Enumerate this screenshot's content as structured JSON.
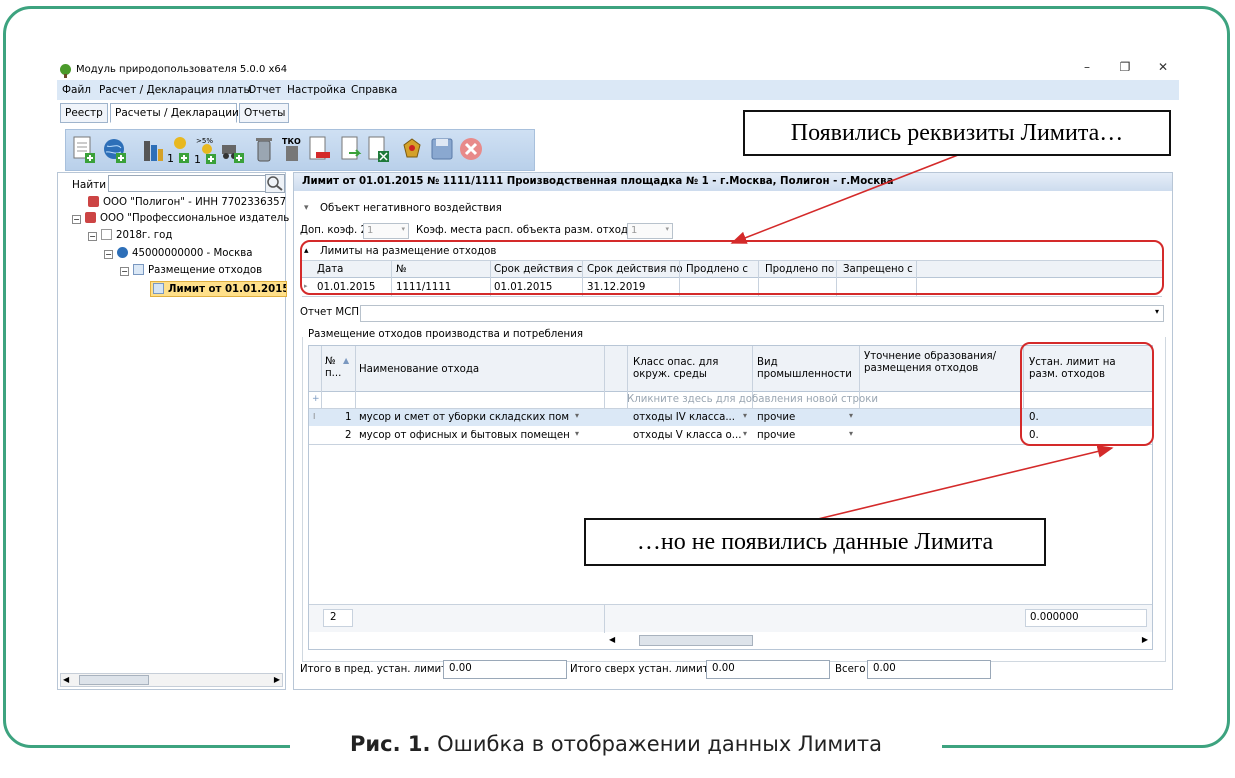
{
  "window": {
    "title": "Модуль природопользователя 5.0.0 x64"
  },
  "menu": [
    "Файл",
    "Расчет / Декларация платы",
    "Отчет",
    "Настройка",
    "Справка"
  ],
  "tabs": [
    {
      "label": "Реестр"
    },
    {
      "label": "Расчеты / Декларации"
    },
    {
      "label": "Отчеты"
    }
  ],
  "toolbar": {
    "badges": {
      "one_a": "1",
      "pct": ">5%",
      "one_b": "1",
      "tko": "ТКО"
    }
  },
  "search": {
    "label": "Найти",
    "value": ""
  },
  "tree": [
    {
      "label": "ООО \"Полигон\" - ИНН 7702336357"
    },
    {
      "label": "ООО \"Профессиональное издатель"
    },
    {
      "label": "2018г. год"
    },
    {
      "label": "45000000000 - Москва"
    },
    {
      "label": "Размещение отходов"
    },
    {
      "label": "Лимит от 01.01.2015 N"
    }
  ],
  "detail": {
    "header": "Лимит от 01.01.2015 № 1111/1111 Производственная площадка № 1 - г.Москва, Полигон - г.Москва",
    "object_section": "Объект негативного воздействия",
    "dop_koef_label": "Доп. коэф. 2",
    "dop_koef_value": "1",
    "koef_place_label": "Коэф. места расп. объекта разм. отходов",
    "koef_place_value": "1",
    "limits_section": "Лимиты на размещение отходов",
    "limits_columns": [
      "Дата",
      "№",
      "Срок действия с",
      "Срок действия по",
      "Продлено с",
      "Продлено по",
      "Запрещено с"
    ],
    "limits_row": [
      "01.01.2015",
      "1111/1111",
      "01.01.2015",
      "31.12.2019",
      "",
      "",
      ""
    ],
    "report_msp_label": "Отчет МСП",
    "waste_section": "Размещение отходов производства и потребления",
    "waste_columns": {
      "num": "№ п...",
      "name": "Наименование отхода",
      "class": "Класс опас. для окруж. среды",
      "industry": "Вид промышленности",
      "clarify": "Уточнение образования/размещения отходов",
      "limit": "Устан. лимит на разм. отходов"
    },
    "new_row_hint": "Кликните здесь для добавления новой строки",
    "waste_rows": [
      {
        "num": "1",
        "name": "мусор и смет от уборки складских поме...",
        "class": "отходы IV класса...",
        "industry": "прочие",
        "clarify": "",
        "limit": "0."
      },
      {
        "num": "2",
        "name": "мусор от офисных и бытовых помещен...",
        "class": "отходы V класса о...",
        "industry": "прочие",
        "clarify": "",
        "limit": "0."
      }
    ],
    "footer_count": "2",
    "footer_total": "0.000000",
    "totals": {
      "within_label": "Итого в пред. устан. лимита",
      "within_value": "0.00",
      "over_label": "Итого сверх устан. лимита",
      "over_value": "0.00",
      "all_label": "Всего",
      "all_value": "0.00"
    }
  },
  "callouts": {
    "top": "Появились реквизиты Лимита…",
    "bottom": "…но не появились данные Лимита"
  },
  "figure": {
    "number": "Рис. 1.",
    "text": "Ошибка в отображении данных Лимита"
  },
  "colors": {
    "frame": "#3da37f",
    "highlight": "#d42a2a",
    "menu_bg": "#dbe8f6",
    "selected_node": "#ffe08a"
  }
}
